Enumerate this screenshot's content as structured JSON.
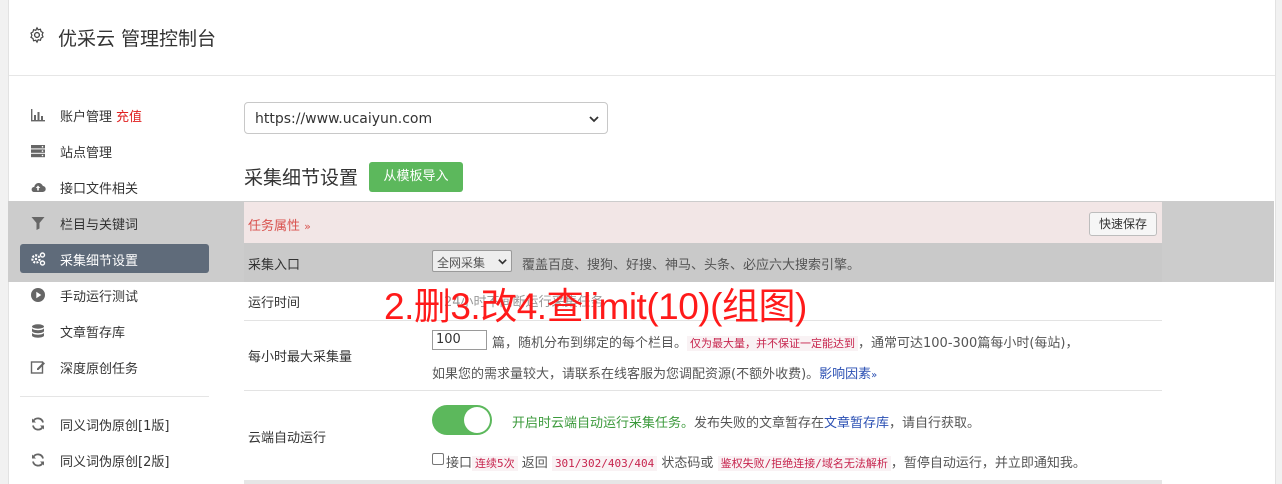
{
  "header": {
    "title": "优采云 管理控制台"
  },
  "sidebar": {
    "items": [
      {
        "label": "账户管理",
        "extra": "充值"
      },
      {
        "label": "站点管理"
      },
      {
        "label": "接口文件相关"
      },
      {
        "label": "栏目与关键词"
      },
      {
        "label": "采集细节设置"
      },
      {
        "label": "手动运行测试"
      },
      {
        "label": "文章暂存库"
      },
      {
        "label": "深度原创任务"
      },
      {
        "label": "同义词伪原创[1版]"
      },
      {
        "label": "同义词伪原创[2版]"
      }
    ]
  },
  "site_select": {
    "value": "https://www.ucaiyun.com"
  },
  "section": {
    "title": "采集细节设置",
    "import_button": "从模板导入",
    "attr_tab": "任务属性",
    "attr_chevron": "»",
    "quick_save": "快速保存"
  },
  "rows": {
    "entry": {
      "label": "采集入口",
      "select_value": "全网采集",
      "desc": "覆盖百度、搜狗、好搜、神马、头条、必应六大搜索引擎。"
    },
    "runtime": {
      "label": "运行时间",
      "ghost": "24小时不间断运行采集任务"
    },
    "max": {
      "label": "每小时最大采集量",
      "input_value": "100",
      "line1_a": "篇，随机分布到绑定的每个栏目。",
      "line1_code": "仅为最大量，并不保证一定能达到",
      "line1_b": "，通常可达100-300篇每小时(每站)，",
      "line2_a": "如果您的需求量较大，请联系在线客服为您调配资源(不额外收费)。",
      "line2_link": "影响因素",
      "line2_chev": "»"
    },
    "cloud": {
      "label": "云端自动运行",
      "toggle_on": true,
      "desc_green": "开启时云端自动运行采集任务。",
      "desc_a": "发布失败的文章暂存在",
      "desc_link": "文章暂存库",
      "desc_b": "，请自行获取。",
      "chk_a": "接口",
      "chk_code1": "连续5次",
      "chk_b": "返回",
      "chk_code2": "301/302/403/404",
      "chk_c": "状态码或",
      "chk_code3": "鉴权失败/拒绝连接/域名无法解析",
      "chk_d": "，暂停自动运行，并立即通知我。"
    }
  },
  "annotation": {
    "text": "2.删3.改4.查limit(10)(组图)"
  },
  "colors": {
    "accent_green": "#5cb85c",
    "active_sidebar": "#5f6b7a",
    "danger": "#d9534f"
  }
}
